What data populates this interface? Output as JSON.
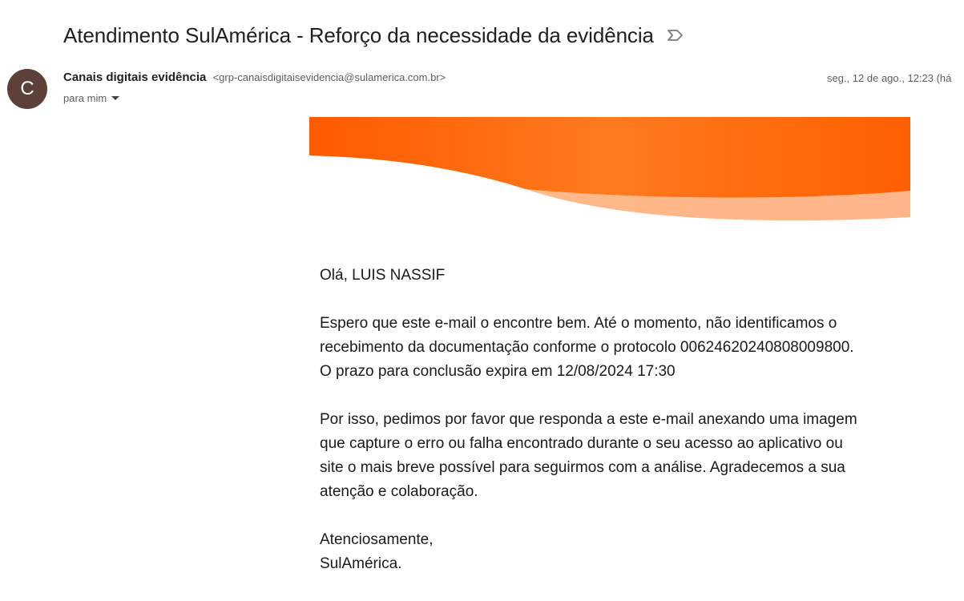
{
  "email": {
    "subject": "Atendimento SulAmérica - Reforço da necessidade da evidência",
    "sender": {
      "avatar_letter": "C",
      "avatar_color": "#5d4037",
      "name": "Canais digitais evidência",
      "email": "<grp-canaisdigitaisevidencia@sulamerica.com.br>"
    },
    "recipient_label": "para mim",
    "date": "seg., 12 de ago., 12:23 (há",
    "banner_colors": [
      "#ff5a00",
      "#ff8a2a",
      "#ffc9a0"
    ],
    "body": {
      "greeting": "Olá, LUIS NASSIF",
      "paragraph1": "Espero que este e-mail o encontre bem. Até o momento, não identificamos o recebimento da documentação conforme o protocolo 00624620240808009800. O prazo para conclusão expira em 12/08/2024 17:30",
      "paragraph2": "Por isso, pedimos por favor que responda a este e-mail anexando uma imagem que capture o erro ou falha encontrado durante o seu acesso ao aplicativo ou site o mais breve possível para seguirmos com a análise. Agradecemos a sua atenção e colaboração.",
      "closing": "Atenciosamente,",
      "signature": "SulAmérica."
    }
  }
}
